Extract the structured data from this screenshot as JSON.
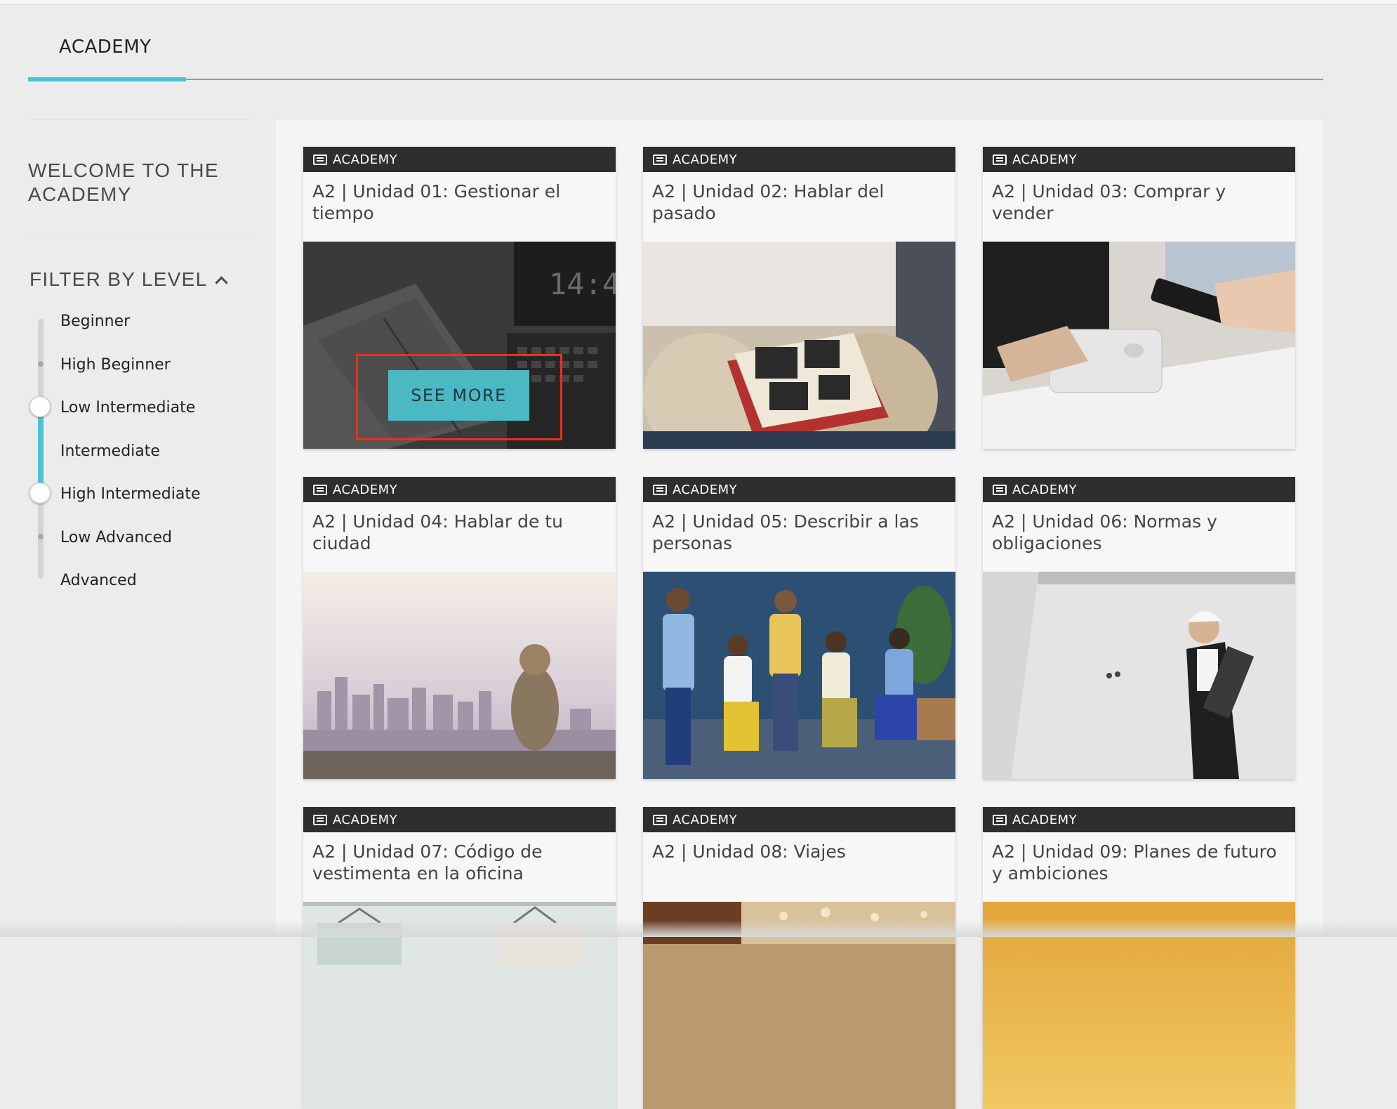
{
  "tabs": [
    {
      "label": "ACADEMY",
      "active": true
    }
  ],
  "sidebar": {
    "welcome": "WELCOME TO THE ACADEMY",
    "filter_label": "FILTER BY LEVEL",
    "levels": [
      "Beginner",
      "High Beginner",
      "Low Intermediate",
      "Intermediate",
      "High Intermediate",
      "Low Advanced",
      "Advanced"
    ],
    "selected_range": {
      "from": "Low Intermediate",
      "to": "High Intermediate"
    }
  },
  "colors": {
    "accent": "#4bc3d4",
    "category_bar": "#2e2e2e",
    "see_more_bg": "#4bb8c4",
    "highlight_frame": "#e8321e"
  },
  "cards": [
    {
      "category": "ACADEMY",
      "title": "A2 | Unidad 01: Gestionar el tiempo",
      "image": "notebook-laptop-clock",
      "clock_text": "14:4",
      "action": "SEE MORE"
    },
    {
      "category": "ACADEMY",
      "title": "A2 | Unidad 02: Hablar del pasado",
      "image": "photo-album"
    },
    {
      "category": "ACADEMY",
      "title": "A2 | Unidad 03: Comprar y vender",
      "image": "card-payment"
    },
    {
      "category": "ACADEMY",
      "title": "A2 | Unidad 04: Hablar de tu ciudad",
      "image": "city-view"
    },
    {
      "category": "ACADEMY",
      "title": "A2 | Unidad 05: Describir a las personas",
      "image": "group-of-people"
    },
    {
      "category": "ACADEMY",
      "title": "A2 | Unidad 06: Normas y obligaciones",
      "image": "inspector-clipboard"
    },
    {
      "category": "ACADEMY",
      "title": "A2 | Unidad 07: Código de vestimenta en la oficina",
      "image": "clothes-rack"
    },
    {
      "category": "ACADEMY",
      "title": "A2 | Unidad 08: Viajes",
      "image": "travel"
    },
    {
      "category": "ACADEMY",
      "title": "A2 | Unidad 09: Planes de futuro y ambiciones",
      "image": "sunset"
    }
  ]
}
